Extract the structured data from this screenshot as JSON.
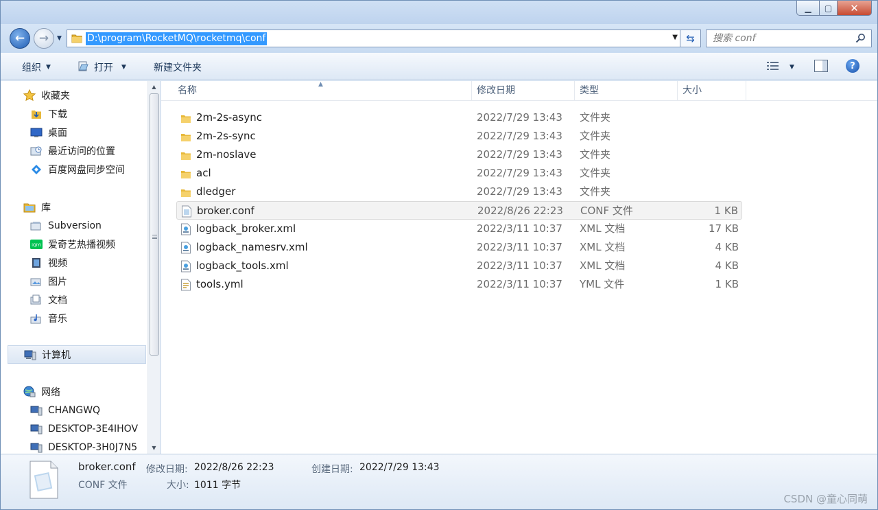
{
  "address": {
    "path": "D:\\program\\RocketMQ\\rocketmq\\conf"
  },
  "search": {
    "placeholder": "搜索 conf"
  },
  "toolbar": {
    "organize": "组织",
    "open": "打开",
    "new_folder": "新建文件夹"
  },
  "nav": {
    "favorites": {
      "label": "收藏夹",
      "items": [
        "下载",
        "桌面",
        "最近访问的位置",
        "百度网盘同步空间"
      ]
    },
    "library": {
      "label": "库",
      "items": [
        "Subversion",
        "爱奇艺热播视频",
        "视频",
        "图片",
        "文档",
        "音乐"
      ]
    },
    "computer": {
      "label": "计算机"
    },
    "network": {
      "label": "网络",
      "items": [
        "CHANGWQ",
        "DESKTOP-3E4IHOV",
        "DESKTOP-3H0J7N5"
      ]
    }
  },
  "columns": {
    "name": "名称",
    "date": "修改日期",
    "type": "类型",
    "size": "大小"
  },
  "files": [
    {
      "name": "2m-2s-async",
      "date": "2022/7/29 13:43",
      "type": "文件夹",
      "size": "",
      "kind": "folder"
    },
    {
      "name": "2m-2s-sync",
      "date": "2022/7/29 13:43",
      "type": "文件夹",
      "size": "",
      "kind": "folder"
    },
    {
      "name": "2m-noslave",
      "date": "2022/7/29 13:43",
      "type": "文件夹",
      "size": "",
      "kind": "folder"
    },
    {
      "name": "acl",
      "date": "2022/7/29 13:43",
      "type": "文件夹",
      "size": "",
      "kind": "folder"
    },
    {
      "name": "dledger",
      "date": "2022/7/29 13:43",
      "type": "文件夹",
      "size": "",
      "kind": "folder"
    },
    {
      "name": "broker.conf",
      "date": "2022/8/26 22:23",
      "type": "CONF 文件",
      "size": "1 KB",
      "kind": "conf",
      "selected": true
    },
    {
      "name": "logback_broker.xml",
      "date": "2022/3/11 10:37",
      "type": "XML 文档",
      "size": "17 KB",
      "kind": "xml"
    },
    {
      "name": "logback_namesrv.xml",
      "date": "2022/3/11 10:37",
      "type": "XML 文档",
      "size": "4 KB",
      "kind": "xml"
    },
    {
      "name": "logback_tools.xml",
      "date": "2022/3/11 10:37",
      "type": "XML 文档",
      "size": "4 KB",
      "kind": "xml"
    },
    {
      "name": "tools.yml",
      "date": "2022/3/11 10:37",
      "type": "YML 文件",
      "size": "1 KB",
      "kind": "yml"
    }
  ],
  "details": {
    "name": "broker.conf",
    "type": "CONF 文件",
    "modified_label": "修改日期:",
    "modified": "2022/8/26 22:23",
    "created_label": "创建日期:",
    "created": "2022/7/29 13:43",
    "size_label": "大小:",
    "size": "1011 字节"
  },
  "watermark": "CSDN @童心同萌",
  "colors": {
    "selection": "#3399ff",
    "folder": "#f2c94c",
    "accent": "#1f5cb3"
  }
}
